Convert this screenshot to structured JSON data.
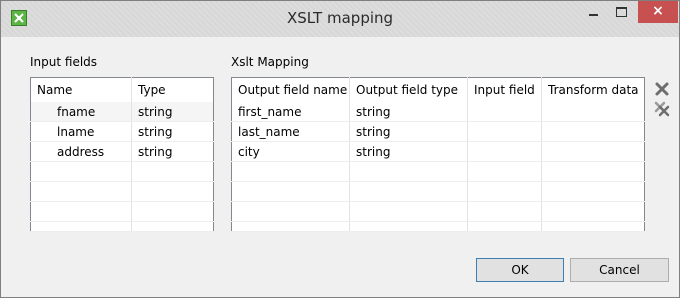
{
  "window": {
    "title": "XSLT mapping",
    "close_glyph": "×"
  },
  "input_fields": {
    "label": "Input fields",
    "columns": [
      "Name",
      "Type"
    ],
    "rows": [
      {
        "name": "fname",
        "type": "string"
      },
      {
        "name": "lname",
        "type": "string"
      },
      {
        "name": "address",
        "type": "string"
      }
    ]
  },
  "xslt_mapping": {
    "label": "Xslt Mapping",
    "columns": [
      "Output field name",
      "Output field type",
      "Input field",
      "Transform data"
    ],
    "rows": [
      {
        "output_field_name": "first_name",
        "output_field_type": "string",
        "input_field": "",
        "transform_data": ""
      },
      {
        "output_field_name": "last_name",
        "output_field_type": "string",
        "input_field": "",
        "transform_data": ""
      },
      {
        "output_field_name": "city",
        "output_field_type": "string",
        "input_field": "",
        "transform_data": ""
      }
    ]
  },
  "side_icons": [
    "delete-icon",
    "delete-all-icon"
  ],
  "buttons": {
    "ok": "OK",
    "cancel": "Cancel"
  },
  "colors": {
    "close_button": "#c75050",
    "app_icon": "#5db545"
  }
}
